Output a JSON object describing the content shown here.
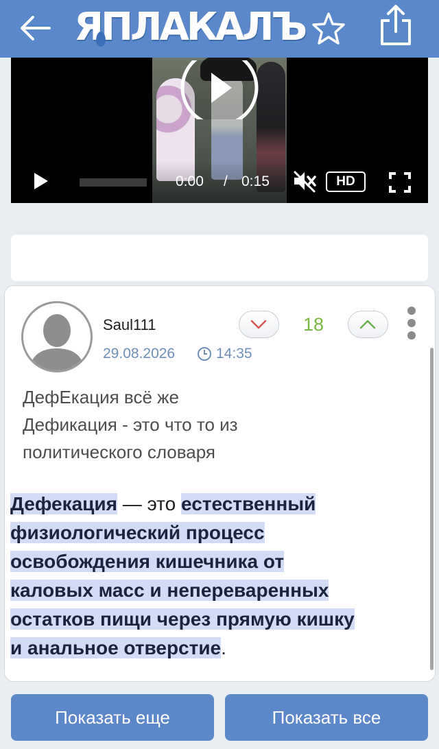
{
  "header": {
    "logo_text": "ЯПЛАКАЛЪ",
    "back_icon": "arrow-left-icon",
    "favorite_icon": "star-icon",
    "share_icon": "share-icon",
    "bar_color": "#5b88cb"
  },
  "video": {
    "current_time": "0:00",
    "separator": "/",
    "duration": "0:15",
    "quality_label": "HD",
    "progress": 0,
    "muted": true
  },
  "comment": {
    "author": "Saul111",
    "date": "29.08.2026",
    "time": "14:35",
    "score": "18",
    "lines": [
      "ДефЕкация всё же",
      "Дефикация - это что то из",
      "политического словаря"
    ],
    "quote_lines": [
      {
        "parts": [
          {
            "t": "Дефекация",
            "hl": true
          },
          {
            "t": " — это ",
            "hl": false
          },
          {
            "t": "естественный",
            "hl": true
          }
        ]
      },
      {
        "parts": [
          {
            "t": "физиологический процесс",
            "hl": true
          }
        ]
      },
      {
        "parts": [
          {
            "t": "освобождения кишечника от",
            "hl": true
          }
        ]
      },
      {
        "parts": [
          {
            "t": "каловых масс и непереваренных",
            "hl": true
          }
        ]
      },
      {
        "parts": [
          {
            "t": "остатков пищи через прямую кишку",
            "hl": true
          }
        ]
      },
      {
        "parts": [
          {
            "t": "и анальное отверстие",
            "hl": true
          },
          {
            "t": ".",
            "hl": false
          }
        ]
      }
    ]
  },
  "footer": {
    "show_more_label": "Показать еще",
    "show_all_label": "Показать все",
    "button_color": "#5c87c9"
  }
}
